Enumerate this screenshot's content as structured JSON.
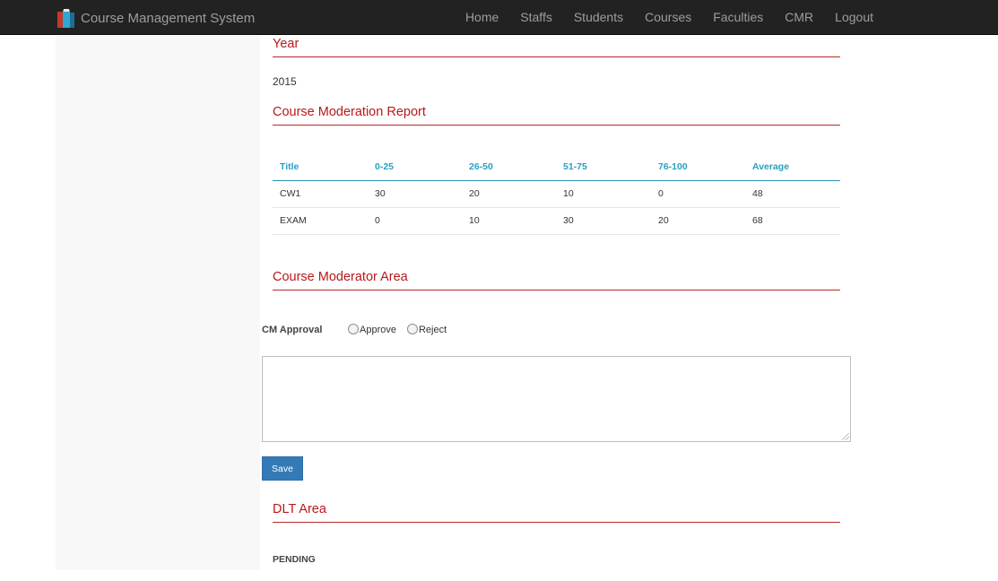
{
  "app": {
    "title": "Course Management System",
    "colors": {
      "navbar": "#222222",
      "section_title": "#b9181b",
      "table_header": "#2a9fc3",
      "primary_button": "#337ab7"
    }
  },
  "nav": {
    "items": [
      {
        "label": "Home"
      },
      {
        "label": "Staffs"
      },
      {
        "label": "Students"
      },
      {
        "label": "Courses"
      },
      {
        "label": "Faculties"
      },
      {
        "label": "CMR"
      },
      {
        "label": "Logout"
      }
    ]
  },
  "year": {
    "heading": "Year",
    "value": "2015"
  },
  "report": {
    "heading": "Course Moderation Report",
    "columns": [
      "Title",
      "0-25",
      "26-50",
      "51-75",
      "76-100",
      "Average"
    ],
    "rows": [
      [
        "CW1",
        "30",
        "20",
        "10",
        "0",
        "48"
      ],
      [
        "EXAM",
        "0",
        "10",
        "30",
        "20",
        "68"
      ]
    ]
  },
  "moderator": {
    "heading": "Course Moderator Area",
    "approval_label": "CM Approval",
    "options": [
      "Approve",
      "Reject"
    ],
    "comment_value": "",
    "save_label": "Save"
  },
  "dlt": {
    "heading": "DLT Area",
    "status": "PENDING"
  }
}
